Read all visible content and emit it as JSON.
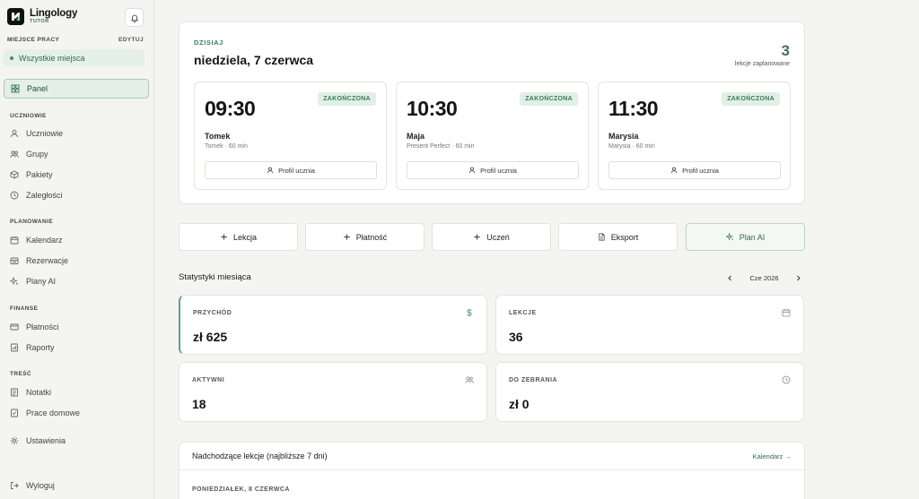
{
  "brand": {
    "name": "Lingology",
    "subtitle": "TUTOR"
  },
  "workspace": {
    "section_label": "MIEJSCE PRACY",
    "edit_label": "EDYTUJ",
    "selected": "Wszystkie miejsca"
  },
  "nav": {
    "panel": "Panel",
    "students_section": "UCZNIOWIE",
    "students": "Uczniowie",
    "groups": "Grupy",
    "packages": "Pakiety",
    "arrears": "Zaległości",
    "planning_section": "PLANOWANIE",
    "calendar": "Kalendarz",
    "reservations": "Rezerwacje",
    "ai_plans": "Plany AI",
    "finance_section": "FINANSE",
    "payments": "Płatności",
    "reports": "Raporty",
    "content_section": "TREŚĆ",
    "notes": "Notatki",
    "homework": "Prace domowe",
    "settings": "Ustawienia",
    "logout": "Wyloguj"
  },
  "today": {
    "label": "DZISIAJ",
    "date": "niedziela, 7 czerwca",
    "count": "3",
    "count_label": "lekcje zaplanowane",
    "lessons": [
      {
        "time": "09:30",
        "status": "ZAKOŃCZONA",
        "name": "Tomek",
        "meta": "Tomek · 60 min",
        "button": "Profil ucznia"
      },
      {
        "time": "10:30",
        "status": "ZAKOŃCZONA",
        "name": "Maja",
        "meta": "Present Perfect · 60 min",
        "button": "Profil ucznia"
      },
      {
        "time": "11:30",
        "status": "ZAKOŃCZONA",
        "name": "Marysia",
        "meta": "Marysia · 60 min",
        "button": "Profil ucznia"
      }
    ]
  },
  "actions": {
    "lesson": "Lekcja",
    "payment": "Płatność",
    "student": "Uczeń",
    "export": "Eksport",
    "ai_plan": "Plan AI"
  },
  "stats": {
    "title": "Statystyki miesiąca",
    "month": "Cze 2026",
    "revenue_label": "PRZYCHÓD",
    "revenue_value": "zł 625",
    "lessons_label": "LEKCJE",
    "lessons_value": "36",
    "active_label": "AKTYWNI",
    "active_value": "18",
    "to_collect_label": "DO ZEBRANIA",
    "to_collect_value": "zł 0"
  },
  "upcoming": {
    "title": "Nadchodzące lekcje (najbliższe 7 dni)",
    "link": "Kalendarz →",
    "first_day": "PONIEDZIAŁEK, 8 CZERWCA"
  },
  "colors": {
    "accent": "#3f7a63",
    "status_bg": "#e1efe5",
    "sidebar_bg": "#f4f4f2"
  }
}
